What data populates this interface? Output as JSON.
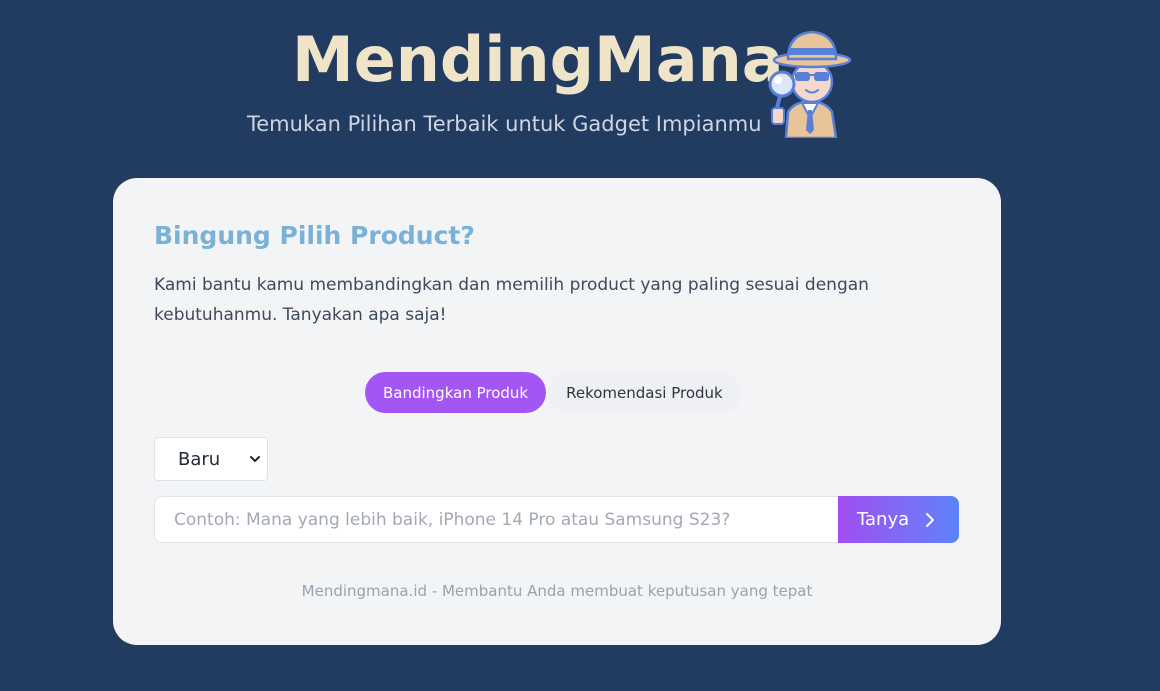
{
  "header": {
    "brand_title": "MendingMana",
    "tagline": "Temukan Pilihan Terbaik untuk Gadget Impianmu",
    "mascot_icon": "detective-mascot-icon"
  },
  "card": {
    "heading": "Bingung Pilih Product?",
    "description": "Kami bantu kamu membandingkan dan memilih product yang paling sesuai dengan kebutuhanmu. Tanyakan apa saja!",
    "tabs": [
      {
        "label": "Bandingkan Produk",
        "active": true
      },
      {
        "label": "Rekomendasi Produk",
        "active": false
      }
    ],
    "condition_select": {
      "selected": "Baru"
    },
    "question_input": {
      "value": "",
      "placeholder": "Contoh: Mana yang lebih baik, iPhone 14 Pro atau Samsung S23?"
    },
    "ask_button": {
      "label": "Tanya",
      "icon": "chevron-right-icon"
    },
    "footer_note": "Mendingmana.id - Membantu Anda membuat keputusan yang tepat"
  },
  "colors": {
    "page_background": "#213b61",
    "card_background": "#f3f4f6",
    "brand_title": "#efe3c8",
    "heading_accent": "#7ab1d6",
    "active_tab": "#a456f4",
    "button_gradient_start": "#a04ef0",
    "button_gradient_end": "#5d82f8"
  }
}
